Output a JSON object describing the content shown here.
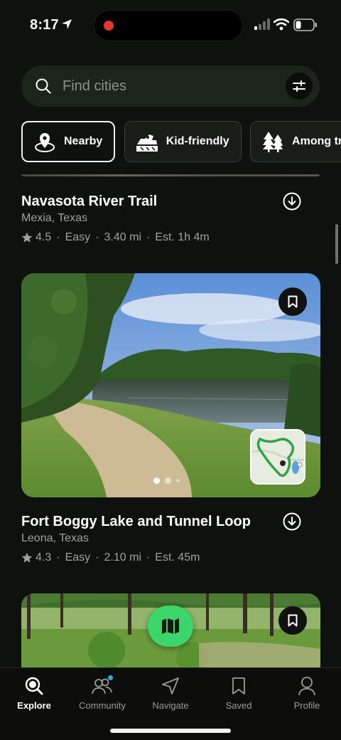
{
  "status_bar": {
    "time": "8:17"
  },
  "search": {
    "placeholder": "Find cities"
  },
  "chips": [
    {
      "label": "Nearby",
      "icon": "location-pin-icon",
      "active": true
    },
    {
      "label": "Kid-friendly",
      "icon": "stroller-icon",
      "active": false
    },
    {
      "label": "Among tre",
      "icon": "trees-icon",
      "active": false
    }
  ],
  "trails": [
    {
      "name": "Navasota River Trail",
      "location": "Mexia, Texas",
      "rating": "4.5",
      "difficulty": "Easy",
      "distance": "3.40 mi",
      "duration": "Est. 1h 4m"
    },
    {
      "name": "Fort Boggy Lake and Tunnel Loop",
      "location": "Leona, Texas",
      "rating": "4.3",
      "difficulty": "Easy",
      "distance": "2.10 mi",
      "duration": "Est. 45m"
    }
  ],
  "separator": "·",
  "tabs": [
    {
      "label": "Explore",
      "icon": "explore-search-icon",
      "active": true
    },
    {
      "label": "Community",
      "icon": "community-icon",
      "active": false
    },
    {
      "label": "Navigate",
      "icon": "navigate-icon",
      "active": false
    },
    {
      "label": "Saved",
      "icon": "bookmark-icon",
      "active": false
    },
    {
      "label": "Profile",
      "icon": "profile-icon",
      "active": false
    }
  ],
  "colors": {
    "background": "#0f110e",
    "accent_green": "#3bd66b",
    "search_bg": "#1c2519",
    "notification_dot": "#3aa2e8",
    "recording_dot": "#e8352e"
  }
}
